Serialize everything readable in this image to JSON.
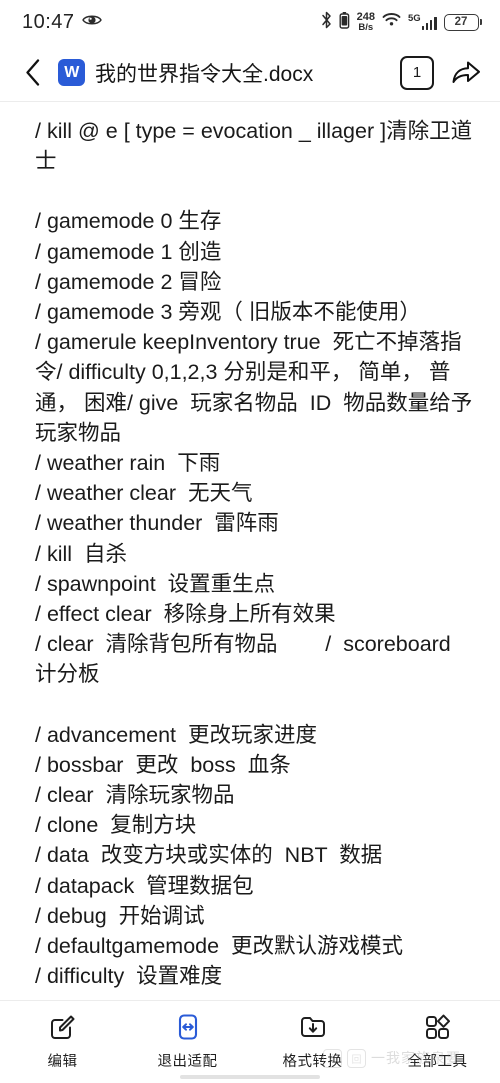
{
  "statusbar": {
    "time": "10:47",
    "eye_icon": "eye-comfort-icon",
    "bluetooth_icon": "bluetooth-icon",
    "device_icon": "connected-device-icon",
    "net_speed_value": "248",
    "net_speed_unit": "B/s",
    "wifi_icon": "wifi-icon",
    "network_type": "5G",
    "signal_icon": "signal-bars-icon",
    "battery_level": "27"
  },
  "header": {
    "back_icon": "chevron-left-icon",
    "app_icon_letter": "W",
    "app_icon_name": "word-document-icon",
    "title": "我的世界指令大全.docx",
    "page_count": "1",
    "share_icon": "share-arrow-icon"
  },
  "document": {
    "blocks": [
      {
        "type": "text",
        "text": "/ kill @ e [ type = evocation _ illager ]清除卫道士"
      },
      {
        "type": "blank"
      },
      {
        "type": "text",
        "text": "/ gamemode 0 生存"
      },
      {
        "type": "text",
        "text": "/ gamemode 1 创造"
      },
      {
        "type": "text",
        "text": "/ gamemode 2 冒险"
      },
      {
        "type": "text",
        "text": "/ gamemode 3 旁观（ 旧版本不能使用）"
      },
      {
        "type": "text",
        "text": "/ gamerule keepInventory true  死亡不掉落指令/ difficulty 0,1,2,3 分别是和平， 简单， 普通， 困难/ give  玩家名物品  ID  物品数量给予玩家物品"
      },
      {
        "type": "text",
        "text": "/ weather rain  下雨"
      },
      {
        "type": "text",
        "text": "/ weather clear  无天气"
      },
      {
        "type": "text",
        "text": "/ weather thunder  雷阵雨"
      },
      {
        "type": "text",
        "text": "/ kill  自杀"
      },
      {
        "type": "text",
        "text": "/ spawnpoint  设置重生点"
      },
      {
        "type": "text",
        "text": "/ effect clear  移除身上所有效果"
      },
      {
        "type": "text",
        "text": "/ clear  清除背包所有物品        /  scoreboard  计分板"
      },
      {
        "type": "blank"
      },
      {
        "type": "text",
        "text": "/ advancement  更改玩家进度"
      },
      {
        "type": "text",
        "text": "/ bossbar  更改  boss  血条"
      },
      {
        "type": "text",
        "text": "/ clear  清除玩家物品"
      },
      {
        "type": "text",
        "text": "/ clone  复制方块"
      },
      {
        "type": "text",
        "text": "/ data  改变方块或实体的  NBT  数据"
      },
      {
        "type": "text",
        "text": "/ datapack  管理数据包"
      },
      {
        "type": "text",
        "text": "/ debug  开始调试"
      },
      {
        "type": "text",
        "text": "/ defaultgamemode  更改默认游戏模式"
      },
      {
        "type": "text",
        "text": "/ difficulty  设置难度"
      }
    ]
  },
  "bottombar": {
    "tools": [
      {
        "label": "编辑",
        "icon": "edit-pencil-icon",
        "active": false
      },
      {
        "label": "退出适配",
        "icon": "exit-fit-arrows-icon",
        "active": true
      },
      {
        "label": "格式转换",
        "icon": "folder-download-icon",
        "active": false
      },
      {
        "label": "全部工具",
        "icon": "grid-apps-icon",
        "active": false
      }
    ],
    "watermark_text": "一我家族泉要"
  },
  "colors": {
    "accent_blue": "#2a5bd7",
    "text_primary": "#1b1b1b",
    "divider": "#ececec"
  }
}
